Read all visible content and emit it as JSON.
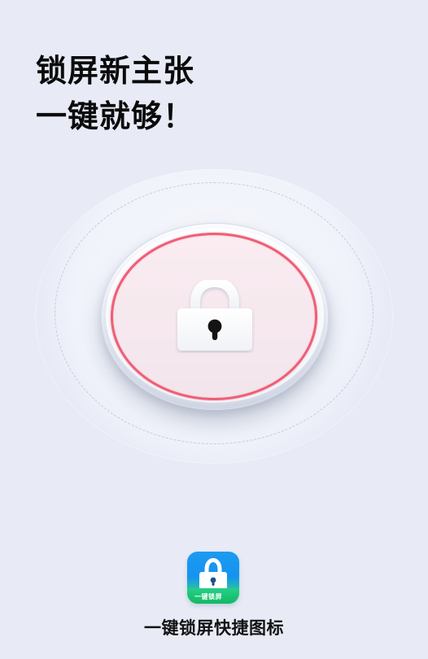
{
  "headline": {
    "line1": "锁屏新主张",
    "line2": "一键就够！"
  },
  "lock_button": {
    "icon": "padlock-icon",
    "ring_color": "#ee5f76"
  },
  "app": {
    "icon_caption": "一键锁屏",
    "name": "一键锁屏快捷图标",
    "icon_colors": {
      "top": "#1d9bf0",
      "bottom": "#18c06d"
    }
  }
}
